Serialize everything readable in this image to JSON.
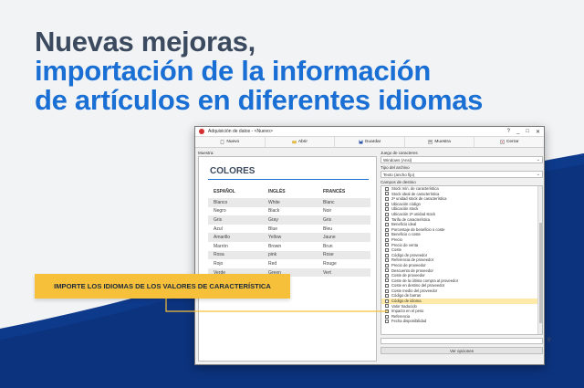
{
  "headline": {
    "line1": "Nuevas mejoras,",
    "line2": "importación de la información",
    "line3": "de artículos en diferentes idiomas"
  },
  "window": {
    "title": "Adquisición de datos - <Nuevo>",
    "controls": [
      "?",
      "_",
      "□",
      "✕"
    ],
    "toolbar": [
      {
        "label": "Nuevo",
        "icon": "new-file-icon"
      },
      {
        "label": "Abrir",
        "icon": "folder-icon"
      },
      {
        "label": "Guardar",
        "icon": "save-icon"
      },
      {
        "label": "Muestra",
        "icon": "sample-icon"
      },
      {
        "label": "Cerrar",
        "icon": "close-icon"
      }
    ],
    "left_label": "Muestra:",
    "sheet": {
      "title": "COLORES",
      "headers": [
        "ESPAÑOL",
        "INGLÉS",
        "FRANCÉS"
      ],
      "rows": [
        [
          "Blanco",
          "White",
          "Blanc"
        ],
        [
          "Negro",
          "Black",
          "Noir"
        ],
        [
          "Gris",
          "Gray",
          "Gris"
        ],
        [
          "Azul",
          "Blue",
          "Bleu"
        ],
        [
          "Amarillo",
          "Yellow",
          "Jaune"
        ],
        [
          "Marrón",
          "Brown",
          "Brun"
        ],
        [
          "Rosa",
          "pink",
          "Rose"
        ],
        [
          "Rojo",
          "Red",
          "Rouge"
        ],
        [
          "Verde",
          "Green",
          "Vert"
        ]
      ]
    },
    "right": {
      "charset_label": "Juego de caracteres",
      "charset_value": "Windows (Ansi)",
      "filetype_label": "Tipo del archivo",
      "filetype_value": "Texto (ancho fijo)",
      "fields_label": "Campos de destino",
      "fields": [
        "Stock mín. de característica",
        "Stock ideal de característica",
        "2ª unidad stock de característica",
        "Ubicación código",
        "Ubicación stock",
        "Ubicación 2ª unidad stock",
        "Tarifa de característica",
        "Beneficio ideal",
        "Porcentaje de beneficio o coste",
        "Beneficio o coste",
        "Precio",
        "Precio de venta",
        "Coste",
        "Código de proveedor",
        "Referencia de proveedor",
        "Precio de proveedor",
        "Descuento de proveedor",
        "Coste de proveedor",
        "Coste de la última compra al proveedor",
        "Coste en destino del proveedor",
        "Coste medio del proveedor",
        "Código de barras",
        "Código de idioma",
        "Valor traducido",
        "Impacto en el peso",
        "Referencia",
        "Fecha disponibilidad"
      ],
      "highlighted_index": 22,
      "options_button": "Ver opciones"
    }
  },
  "callout": "IMPORTE LOS IDIOMAS DE LOS VALORES DE CARACTERÍSTICA",
  "colors": {
    "accent_blue": "#1a6fd4",
    "dark_navy": "#0e3a8c",
    "callout_yellow": "#f6c03a",
    "highlight": "#ffe9a8"
  }
}
